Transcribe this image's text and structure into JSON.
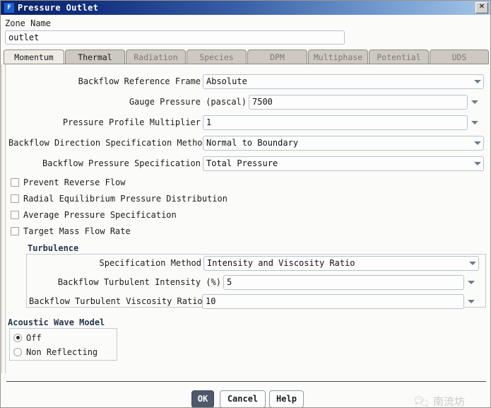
{
  "window": {
    "title": "Pressure Outlet",
    "icon": "F",
    "close_label": "✕"
  },
  "zone": {
    "label": "Zone Name",
    "value": "outlet"
  },
  "tabs": [
    {
      "label": "Momentum",
      "state": "active"
    },
    {
      "label": "Thermal",
      "state": "enabled"
    },
    {
      "label": "Radiation",
      "state": "disabled"
    },
    {
      "label": "Species",
      "state": "disabled"
    },
    {
      "label": "DPM",
      "state": "disabled"
    },
    {
      "label": "Multiphase",
      "state": "disabled"
    },
    {
      "label": "Potential",
      "state": "disabled"
    },
    {
      "label": "UDS",
      "state": "disabled"
    }
  ],
  "momentum": {
    "backflow_reference_frame": {
      "label": "Backflow Reference Frame",
      "value": "Absolute"
    },
    "gauge_pressure": {
      "label": "Gauge Pressure (pascal)",
      "value": "7500"
    },
    "pressure_profile_multiplier": {
      "label": "Pressure Profile Multiplier",
      "value": "1"
    },
    "backflow_direction_spec_method": {
      "label": "Backflow Direction Specification Method",
      "value": "Normal to Boundary"
    },
    "backflow_pressure_spec": {
      "label": "Backflow Pressure Specification",
      "value": "Total Pressure"
    },
    "checkboxes": [
      {
        "label": "Prevent Reverse Flow",
        "checked": false
      },
      {
        "label": "Radial Equilibrium Pressure Distribution",
        "checked": false
      },
      {
        "label": "Average Pressure Specification",
        "checked": false
      },
      {
        "label": "Target Mass Flow Rate",
        "checked": false
      }
    ]
  },
  "turbulence": {
    "title": "Turbulence",
    "specification_method": {
      "label": "Specification Method",
      "value": "Intensity and Viscosity Ratio"
    },
    "backflow_turbulent_intensity": {
      "label": "Backflow Turbulent Intensity (%)",
      "value": "5"
    },
    "backflow_turbulent_viscosity_ratio": {
      "label": "Backflow Turbulent Viscosity Ratio",
      "value": "10"
    }
  },
  "acoustic_wave_model": {
    "title": "Acoustic Wave Model",
    "options": [
      {
        "label": "Off",
        "selected": true
      },
      {
        "label": "Non Reflecting",
        "selected": false
      }
    ]
  },
  "footer": {
    "ok": "OK",
    "cancel": "Cancel",
    "help": "Help"
  },
  "watermark": {
    "text": "南流坊"
  },
  "colors": {
    "title_bar_start": "#0a246a",
    "title_bar_end": "#a8c6e8",
    "ok_button": "#4e5a6b",
    "group_title": "#26354d",
    "field_border": "#b9c2d0",
    "tab_inactive": "#cdc9c0",
    "tab_active": "#eeebe4"
  }
}
